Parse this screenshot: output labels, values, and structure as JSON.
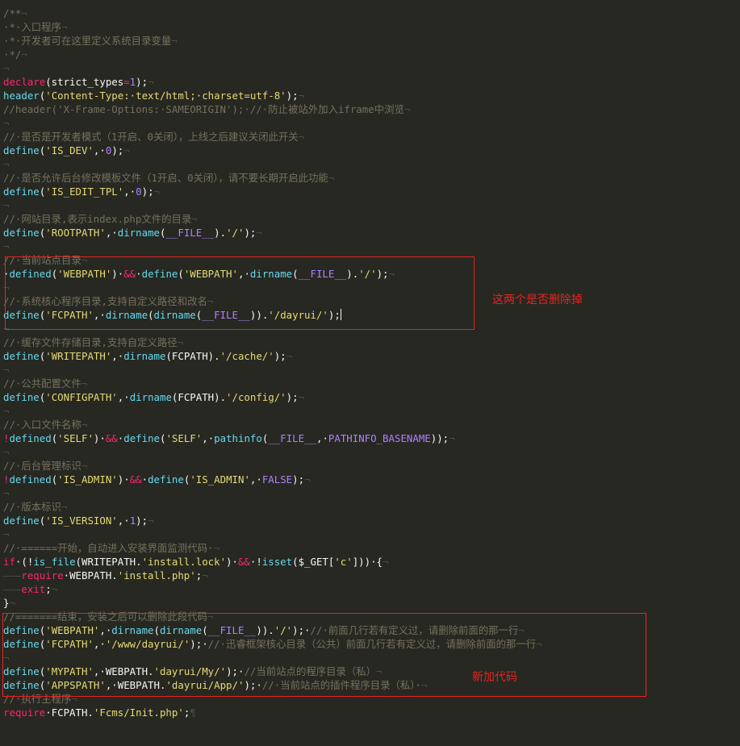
{
  "colors": {
    "background": "#272822",
    "comment": "#75715E",
    "keyword": "#F92672",
    "function": "#66D9EF",
    "string": "#E6DB74",
    "number": "#AE81FF",
    "plain": "#F8F8F2",
    "annotation": "#E8231F"
  },
  "annotations": {
    "top_note": "这两个是否删除掉",
    "bottom_note": "新加代码"
  },
  "code_lines": [
    [
      [
        "c",
        "/**"
      ],
      [
        "w",
        "¬"
      ]
    ],
    [
      [
        "c",
        "·*·入口程序"
      ],
      [
        "w",
        "¬"
      ]
    ],
    [
      [
        "c",
        "·*·开发者可在这里定义系统目录变量"
      ],
      [
        "w",
        "¬"
      ]
    ],
    [
      [
        "c",
        "·*/"
      ],
      [
        "w",
        "¬"
      ]
    ],
    [
      [
        "w",
        "¬"
      ]
    ],
    [
      [
        "k",
        "declare"
      ],
      [
        "p",
        "(strict_types"
      ],
      [
        "k",
        "="
      ],
      [
        "n",
        "1"
      ],
      [
        "p",
        ");"
      ],
      [
        "w",
        "¬"
      ]
    ],
    [
      [
        "f",
        "header"
      ],
      [
        "p",
        "("
      ],
      [
        "s",
        "'Content-Type:·text/html;·charset=utf-8'"
      ],
      [
        "p",
        ");"
      ],
      [
        "w",
        "¬"
      ]
    ],
    [
      [
        "c",
        "//header('X-Frame-Options:·SAMEORIGIN');·//·防止被站外加入iframe中浏览"
      ],
      [
        "w",
        "¬"
      ]
    ],
    [
      [
        "w",
        "¬"
      ]
    ],
    [
      [
        "c",
        "//·是否是开发者模式（1开启、0关闭），上线之后建议关闭此开关"
      ],
      [
        "w",
        "¬"
      ]
    ],
    [
      [
        "f",
        "define"
      ],
      [
        "p",
        "("
      ],
      [
        "s",
        "'IS_DEV'"
      ],
      [
        "p",
        ",·"
      ],
      [
        "n",
        "0"
      ],
      [
        "p",
        ");"
      ],
      [
        "w",
        "¬"
      ]
    ],
    [
      [
        "w",
        "¬"
      ]
    ],
    [
      [
        "c",
        "//·是否允许后台修改模板文件（1开启、0关闭），请不要长期开启此功能"
      ],
      [
        "w",
        "¬"
      ]
    ],
    [
      [
        "f",
        "define"
      ],
      [
        "p",
        "("
      ],
      [
        "s",
        "'IS_EDIT_TPL'"
      ],
      [
        "p",
        ",·"
      ],
      [
        "n",
        "0"
      ],
      [
        "p",
        ");"
      ],
      [
        "w",
        "¬"
      ]
    ],
    [
      [
        "w",
        "¬"
      ]
    ],
    [
      [
        "c",
        "//·网站目录,表示index.php文件的目录"
      ],
      [
        "w",
        "¬"
      ]
    ],
    [
      [
        "f",
        "define"
      ],
      [
        "p",
        "("
      ],
      [
        "s",
        "'ROOTPATH'"
      ],
      [
        "p",
        ",·"
      ],
      [
        "f",
        "dirname"
      ],
      [
        "p",
        "("
      ],
      [
        "o",
        "__FILE__"
      ],
      [
        "p",
        ")."
      ],
      [
        "s",
        "'/'"
      ],
      [
        "p",
        ");"
      ],
      [
        "w",
        "¬"
      ]
    ],
    [
      [
        "w",
        "¬"
      ]
    ],
    [
      [
        "c",
        "//·当前站点目录"
      ],
      [
        "w",
        "¬"
      ]
    ],
    [
      [
        "p",
        "·"
      ],
      [
        "f",
        "defined"
      ],
      [
        "p",
        "("
      ],
      [
        "s",
        "'WEBPATH'"
      ],
      [
        "p",
        ")·"
      ],
      [
        "k",
        "&&"
      ],
      [
        "p",
        "·"
      ],
      [
        "f",
        "define"
      ],
      [
        "p",
        "("
      ],
      [
        "s",
        "'WEBPATH'"
      ],
      [
        "p",
        ",·"
      ],
      [
        "f",
        "dirname"
      ],
      [
        "p",
        "("
      ],
      [
        "o",
        "__FILE__"
      ],
      [
        "p",
        ")."
      ],
      [
        "s",
        "'/'"
      ],
      [
        "p",
        ");"
      ],
      [
        "w",
        "¬"
      ]
    ],
    [
      [
        "w",
        "¬"
      ]
    ],
    [
      [
        "c",
        "//·系统核心程序目录,支持自定义路径和改名"
      ],
      [
        "w",
        "¬"
      ]
    ],
    [
      [
        "f",
        "define"
      ],
      [
        "p",
        "("
      ],
      [
        "s",
        "'FCPATH'"
      ],
      [
        "p",
        ",·"
      ],
      [
        "f",
        "dirname"
      ],
      [
        "p",
        "("
      ],
      [
        "f",
        "dirname"
      ],
      [
        "p",
        "("
      ],
      [
        "o",
        "__FILE__"
      ],
      [
        "p",
        "))."
      ],
      [
        "s",
        "'/dayrui/'"
      ],
      [
        "p",
        ");"
      ],
      [
        "cur",
        ""
      ]
    ],
    [
      [
        "w",
        "¬"
      ]
    ],
    [
      [
        "c",
        "//·缓存文件存储目录,支持自定义路径"
      ],
      [
        "w",
        "¬"
      ]
    ],
    [
      [
        "f",
        "define"
      ],
      [
        "p",
        "("
      ],
      [
        "s",
        "'WRITEPATH'"
      ],
      [
        "p",
        ",·"
      ],
      [
        "f",
        "dirname"
      ],
      [
        "p",
        "(FCPATH)."
      ],
      [
        "s",
        "'/cache/'"
      ],
      [
        "p",
        ");"
      ],
      [
        "w",
        "¬"
      ]
    ],
    [
      [
        "w",
        "¬"
      ]
    ],
    [
      [
        "c",
        "//·公共配置文件"
      ],
      [
        "w",
        "¬"
      ]
    ],
    [
      [
        "f",
        "define"
      ],
      [
        "p",
        "("
      ],
      [
        "s",
        "'CONFIGPATH'"
      ],
      [
        "p",
        ",·"
      ],
      [
        "f",
        "dirname"
      ],
      [
        "p",
        "(FCPATH)."
      ],
      [
        "s",
        "'/config/'"
      ],
      [
        "p",
        ");"
      ],
      [
        "w",
        "¬"
      ]
    ],
    [
      [
        "w",
        "¬"
      ]
    ],
    [
      [
        "c",
        "//·入口文件名称"
      ],
      [
        "w",
        "¬"
      ]
    ],
    [
      [
        "k",
        "!"
      ],
      [
        "f",
        "defined"
      ],
      [
        "p",
        "("
      ],
      [
        "s",
        "'SELF'"
      ],
      [
        "p",
        ")·"
      ],
      [
        "k",
        "&&"
      ],
      [
        "p",
        "·"
      ],
      [
        "f",
        "define"
      ],
      [
        "p",
        "("
      ],
      [
        "s",
        "'SELF'"
      ],
      [
        "p",
        ",·"
      ],
      [
        "f",
        "pathinfo"
      ],
      [
        "p",
        "("
      ],
      [
        "o",
        "__FILE__"
      ],
      [
        "p",
        ",·"
      ],
      [
        "o",
        "PATHINFO_BASENAME"
      ],
      [
        "p",
        "));"
      ],
      [
        "w",
        "¬"
      ]
    ],
    [
      [
        "w",
        "¬"
      ]
    ],
    [
      [
        "c",
        "//·后台管理标识"
      ],
      [
        "w",
        "¬"
      ]
    ],
    [
      [
        "k",
        "!"
      ],
      [
        "f",
        "defined"
      ],
      [
        "p",
        "("
      ],
      [
        "s",
        "'IS_ADMIN'"
      ],
      [
        "p",
        ")·"
      ],
      [
        "k",
        "&&"
      ],
      [
        "p",
        "·"
      ],
      [
        "f",
        "define"
      ],
      [
        "p",
        "("
      ],
      [
        "s",
        "'IS_ADMIN'"
      ],
      [
        "p",
        ",·"
      ],
      [
        "o",
        "FALSE"
      ],
      [
        "p",
        ");"
      ],
      [
        "w",
        "¬"
      ]
    ],
    [
      [
        "w",
        "¬"
      ]
    ],
    [
      [
        "c",
        "//·版本标识"
      ],
      [
        "w",
        "¬"
      ]
    ],
    [
      [
        "f",
        "define"
      ],
      [
        "p",
        "("
      ],
      [
        "s",
        "'IS_VERSION'"
      ],
      [
        "p",
        ",·"
      ],
      [
        "n",
        "1"
      ],
      [
        "p",
        ");"
      ],
      [
        "w",
        "¬"
      ]
    ],
    [
      [
        "w",
        "¬"
      ]
    ],
    [
      [
        "c",
        "//·======开始，自动进入安装界面监测代码·"
      ],
      [
        "w",
        "¬"
      ]
    ],
    [
      [
        "k",
        "if"
      ],
      [
        "p",
        "·(!"
      ],
      [
        "f",
        "is_file"
      ],
      [
        "p",
        "(WRITEPATH."
      ],
      [
        "s",
        "'install.lock'"
      ],
      [
        "p",
        ")·"
      ],
      [
        "k",
        "&&"
      ],
      [
        "p",
        "·!"
      ],
      [
        "f",
        "isset"
      ],
      [
        "p",
        "($_GET["
      ],
      [
        "s",
        "'c'"
      ],
      [
        "p",
        "]))·{"
      ],
      [
        "w",
        "¬"
      ]
    ],
    [
      [
        "w",
        "———"
      ],
      [
        "k",
        "require"
      ],
      [
        "p",
        "·WEBPATH."
      ],
      [
        "s",
        "'install.php'"
      ],
      [
        "p",
        ";"
      ],
      [
        "w",
        "¬"
      ]
    ],
    [
      [
        "w",
        "———"
      ],
      [
        "k",
        "exit"
      ],
      [
        "p",
        ";"
      ],
      [
        "w",
        "¬"
      ]
    ],
    [
      [
        "p",
        "}"
      ],
      [
        "w",
        "¬"
      ]
    ],
    [
      [
        "c",
        "//=======结束，安装之后可以删除此段代码"
      ],
      [
        "w",
        "¬"
      ]
    ],
    [
      [
        "f",
        "define"
      ],
      [
        "p",
        "("
      ],
      [
        "s",
        "'WEBPATH'"
      ],
      [
        "p",
        ",·"
      ],
      [
        "f",
        "dirname"
      ],
      [
        "p",
        "("
      ],
      [
        "f",
        "dirname"
      ],
      [
        "p",
        "("
      ],
      [
        "o",
        "__FILE__"
      ],
      [
        "p",
        "))."
      ],
      [
        "s",
        "'/'"
      ],
      [
        "p",
        ");·"
      ],
      [
        "c",
        "//·前面几行若有定义过，请删除前面的那一行"
      ],
      [
        "w",
        "¬"
      ]
    ],
    [
      [
        "f",
        "define"
      ],
      [
        "p",
        "("
      ],
      [
        "s",
        "'FCPATH'"
      ],
      [
        "p",
        ",·"
      ],
      [
        "s",
        "'/www/dayrui/'"
      ],
      [
        "p",
        ");·"
      ],
      [
        "c",
        "//·迅睿框架核心目录（公共）前面几行若有定义过，请删除前面的那一行"
      ],
      [
        "w",
        "¬"
      ]
    ],
    [
      [
        "w",
        "¬"
      ]
    ],
    [
      [
        "f",
        "define"
      ],
      [
        "p",
        "("
      ],
      [
        "s",
        "'MYPATH'"
      ],
      [
        "p",
        ",·WEBPATH."
      ],
      [
        "s",
        "'dayrui/My/'"
      ],
      [
        "p",
        ");·"
      ],
      [
        "c",
        "//当前站点的程序目录（私）"
      ],
      [
        "w",
        "¬"
      ]
    ],
    [
      [
        "f",
        "define"
      ],
      [
        "p",
        "("
      ],
      [
        "s",
        "'APPSPATH'"
      ],
      [
        "p",
        ",·WEBPATH."
      ],
      [
        "s",
        "'dayrui/App/'"
      ],
      [
        "p",
        ");·"
      ],
      [
        "c",
        "//·当前站点的插件程序目录（私）·"
      ],
      [
        "w",
        "¬"
      ]
    ],
    [
      [
        "c",
        "//·执行主程序"
      ],
      [
        "w",
        "¬"
      ]
    ],
    [
      [
        "k",
        "require"
      ],
      [
        "p",
        "·FCPATH."
      ],
      [
        "s",
        "'Fcms/Init.php'"
      ],
      [
        "p",
        ";"
      ],
      [
        "w",
        "¶"
      ]
    ]
  ]
}
